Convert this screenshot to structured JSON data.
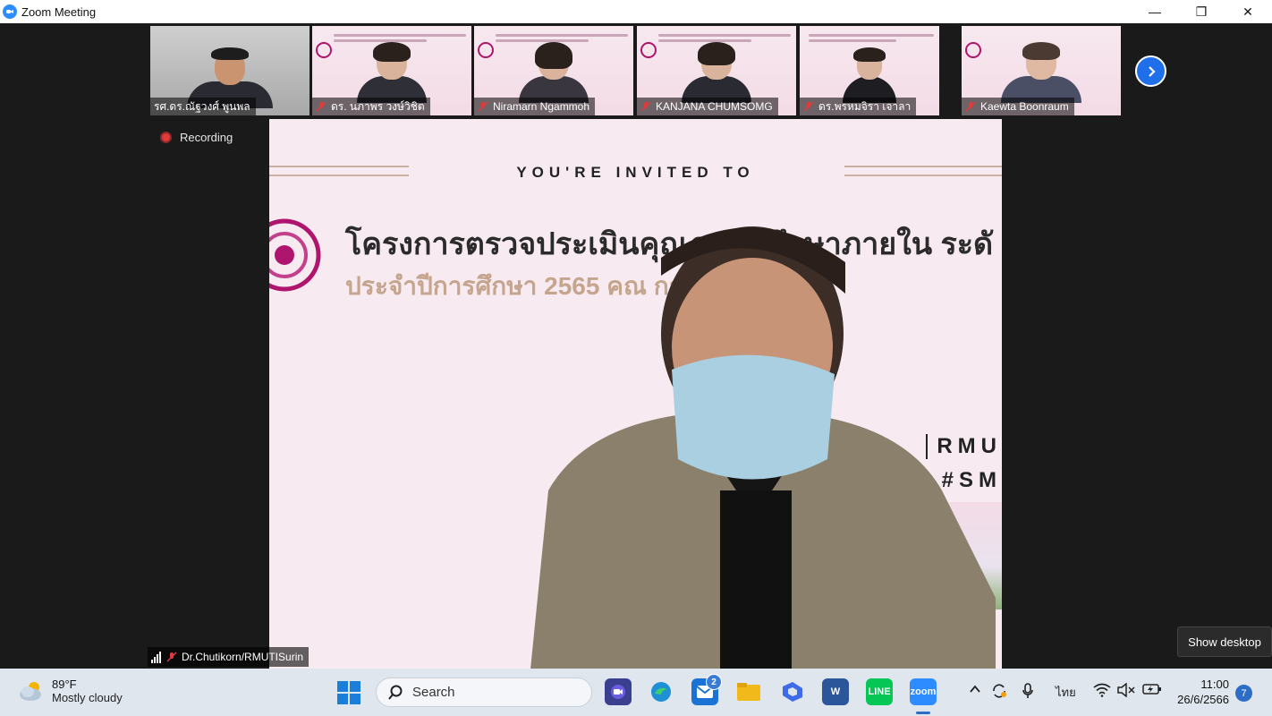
{
  "window": {
    "title": "Zoom Meeting",
    "minimize_glyph": "—",
    "restore_glyph": "❐",
    "close_glyph": "✕"
  },
  "gallery": {
    "participants": [
      {
        "name": "รศ.ดร.ณัฐวงศ์ พูนพล",
        "muted": false
      },
      {
        "name": "ดร. นภาพร วงษ์วิชิต",
        "muted": true
      },
      {
        "name": "Niramarn Ngammoh",
        "muted": true
      },
      {
        "name": "KANJANA CHUMSOMG",
        "muted": true
      },
      {
        "name": "ดร.พรหมจิรา เจาลา",
        "muted": true
      },
      {
        "name": "Kaewta Boonraum",
        "muted": true
      }
    ],
    "next_icon": "chevron-right-icon"
  },
  "recording": {
    "label": "Recording"
  },
  "share": {
    "invited": "YOU'RE INVITED TO",
    "headline": "โครงการตรวจประเมินคุณภา  ารศึกษาภายใน ระดั",
    "subline": "ประจำปีการศึกษา 2565 คณ         การจัดการ",
    "rmu": "RMU",
    "sm": "#SM"
  },
  "speaker": {
    "name": "Dr.Chutikorn/RMUTISurin"
  },
  "show_desktop": "Show desktop",
  "taskbar": {
    "weather_temp": "89°F",
    "weather_desc": "Mostly cloudy",
    "search_placeholder": "Search",
    "mail_badge": "2",
    "language": "ไทย",
    "time": "11:00",
    "date": "26/6/2566",
    "notifications": "7",
    "colors": {
      "zoom": "#2d8cff",
      "line": "#06c755",
      "word": "#2b579a"
    }
  }
}
